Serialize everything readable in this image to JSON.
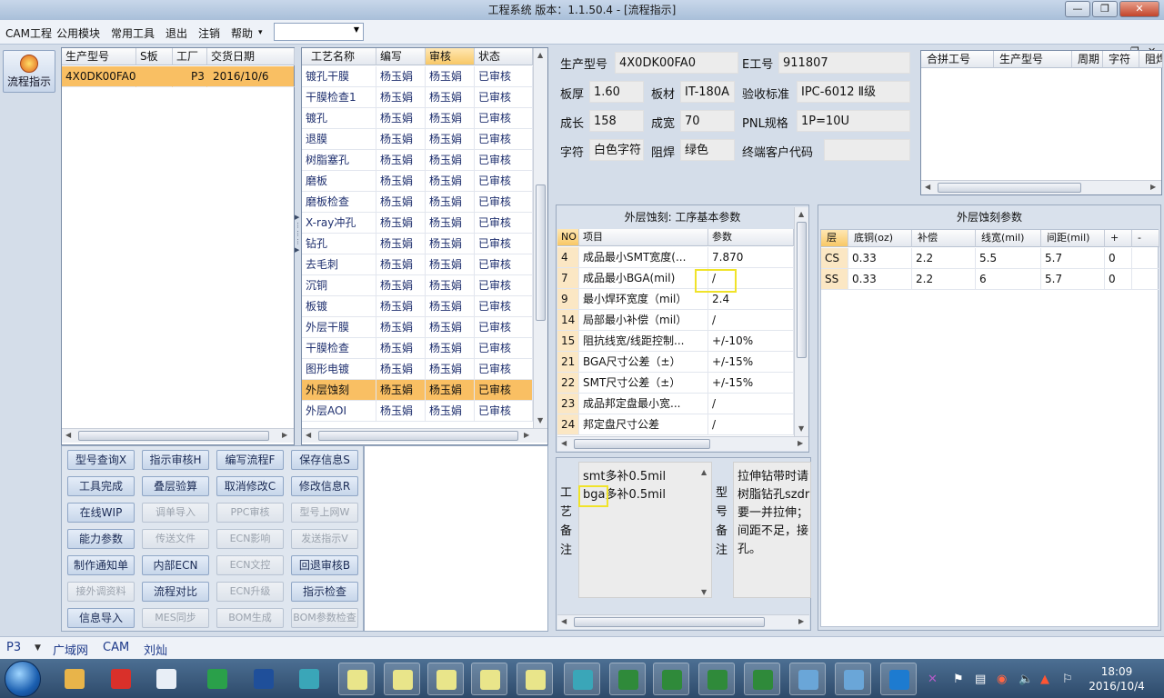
{
  "window": {
    "title": "工程系统   版本：1.1.50.4 - [流程指示]"
  },
  "menu": [
    "CAM工程",
    "公用模块",
    "常用工具",
    "退出",
    "注销",
    "帮助"
  ],
  "menu_combo": {
    "value": ""
  },
  "flow_button": {
    "label": "流程指示"
  },
  "products": {
    "headers": [
      "生产型号",
      "S板",
      "工厂",
      "交货日期"
    ],
    "rows": [
      [
        "4X0DK00FA0",
        "",
        "P3",
        "2016/10/6"
      ]
    ]
  },
  "process": {
    "headers": [
      "工艺名称",
      "编写",
      "审核",
      "状态"
    ],
    "rows": [
      [
        "镀孔干膜",
        "杨玉娟",
        "杨玉娟",
        "已审核"
      ],
      [
        "干膜检查1",
        "杨玉娟",
        "杨玉娟",
        "已审核"
      ],
      [
        "镀孔",
        "杨玉娟",
        "杨玉娟",
        "已审核"
      ],
      [
        "退膜",
        "杨玉娟",
        "杨玉娟",
        "已审核"
      ],
      [
        "树脂塞孔",
        "杨玉娟",
        "杨玉娟",
        "已审核"
      ],
      [
        "磨板",
        "杨玉娟",
        "杨玉娟",
        "已审核"
      ],
      [
        "磨板检查",
        "杨玉娟",
        "杨玉娟",
        "已审核"
      ],
      [
        "X-ray冲孔",
        "杨玉娟",
        "杨玉娟",
        "已审核"
      ],
      [
        "钻孔",
        "杨玉娟",
        "杨玉娟",
        "已审核"
      ],
      [
        "去毛刺",
        "杨玉娟",
        "杨玉娟",
        "已审核"
      ],
      [
        "沉铜",
        "杨玉娟",
        "杨玉娟",
        "已审核"
      ],
      [
        "板镀",
        "杨玉娟",
        "杨玉娟",
        "已审核"
      ],
      [
        "外层干膜",
        "杨玉娟",
        "杨玉娟",
        "已审核"
      ],
      [
        "干膜检查",
        "杨玉娟",
        "杨玉娟",
        "已审核"
      ],
      [
        "图形电镀",
        "杨玉娟",
        "杨玉娟",
        "已审核"
      ],
      [
        "外层蚀刻",
        "杨玉娟",
        "杨玉娟",
        "已审核"
      ],
      [
        "外层AOI",
        "杨玉娟",
        "杨玉娟",
        "已审核"
      ]
    ]
  },
  "buttons": [
    [
      "型号查询X",
      "指示审核H",
      "编写流程F",
      "保存信息S"
    ],
    [
      "工具完成",
      "叠层验算",
      "取消修改C",
      "修改信息R"
    ],
    [
      "在线WIP",
      "调单导入",
      "PPC审核",
      "型号上网W"
    ],
    [
      "能力参数",
      "传送文件",
      "ECN影响",
      "发送指示V"
    ],
    [
      "制作通知单",
      "内部ECN",
      "ECN文控",
      "回退审核B"
    ],
    [
      "接外调资料",
      "流程对比",
      "ECN升级",
      "指示检查"
    ],
    [
      "信息导入",
      "MES同步",
      "BOM生成",
      "BOM参数检查"
    ]
  ],
  "info": {
    "labels": {
      "model": "生产型号",
      "e_no": "E工号",
      "thickness": "板厚",
      "material": "板材",
      "standard": "验收标准",
      "len": "成长",
      "width": "成宽",
      "pnl": "PNL规格",
      "char": "字符",
      "mask": "阻焊",
      "cust": "终端客户代码"
    },
    "values": {
      "model": "4X0DK00FA0",
      "e_no": "911807",
      "thickness": "1.60",
      "material": "IT-180A",
      "standard": "IPC-6012 Ⅱ级",
      "len": "158",
      "width": "70",
      "pnl": "1P=10U",
      "char": "白色字符",
      "mask": "绿色",
      "cust": ""
    }
  },
  "merge": {
    "headers": [
      "合拼工号",
      "生产型号",
      "周期",
      "字符",
      "阻焊"
    ]
  },
  "basic_params": {
    "title": "外层蚀刻: 工序基本参数",
    "headers": [
      "NO",
      "项目",
      "参数"
    ],
    "rows": [
      [
        "4",
        "成品最小SMT宽度(...",
        "7.870"
      ],
      [
        "7",
        "成品最小BGA(mil)",
        "/"
      ],
      [
        "9",
        "最小焊环宽度（mil）",
        "2.4"
      ],
      [
        "14",
        "局部最小补偿（mil）",
        "/"
      ],
      [
        "15",
        "阻抗线宽/线距控制...",
        "+/-10%"
      ],
      [
        "21",
        "BGA尺寸公差（±）",
        "+/-15%"
      ],
      [
        "22",
        "SMT尺寸公差（±）",
        "+/-15%"
      ],
      [
        "23",
        "成品邦定盘最小宽...",
        "/"
      ],
      [
        "24",
        "邦定盘尺寸公差",
        "/"
      ]
    ]
  },
  "etch_params": {
    "title": "外层蚀刻参数",
    "headers": [
      "层",
      "底铜(oz)",
      "补偿",
      "线宽(mil)",
      "间距(mil)",
      "+",
      "-"
    ],
    "rows": [
      [
        "CS",
        "0.33",
        "2.2",
        "5.5",
        "5.7",
        "0",
        ""
      ],
      [
        "SS",
        "0.33",
        "2.2",
        "6",
        "5.7",
        "0",
        ""
      ]
    ]
  },
  "remarks": {
    "process_label": [
      "工",
      "艺",
      "备",
      "注"
    ],
    "process_lines": [
      "smt多补0.5mil",
      "bga多补0.5mil"
    ],
    "model_label": [
      "型",
      "号",
      "备",
      "注"
    ],
    "model_lines": [
      "拉伸钻带时请",
      "树脂钻孔szdr",
      "要一并拉伸；",
      "间距不足，接",
      "孔。"
    ]
  },
  "status": {
    "factory": "P3",
    "items": [
      "广域网",
      "CAM",
      "刘灿"
    ]
  },
  "clock": {
    "time": "18:09",
    "date": "2016/10/4"
  }
}
